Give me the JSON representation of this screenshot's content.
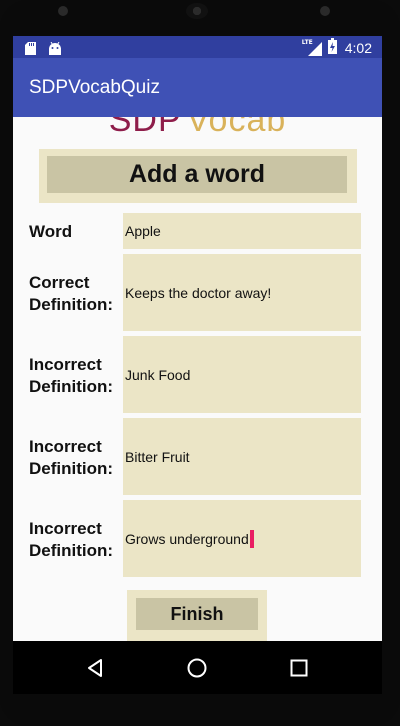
{
  "status_bar": {
    "time": "4:02",
    "network": "LTE",
    "icons": [
      "sd-card-icon",
      "android-icon",
      "signal-icon",
      "battery-icon"
    ]
  },
  "app_bar": {
    "title": "SDPVocabQuiz"
  },
  "logo": {
    "part1": "SDP",
    "part2": "Vocab"
  },
  "header": {
    "title": "Add a word"
  },
  "form": {
    "word_label": "Word",
    "word_value": "Apple",
    "correct_label_line1": "Correct",
    "correct_label_line2": "Definition:",
    "correct_value": "Keeps the doctor away!",
    "incorrect1_label_line1": "Incorrect",
    "incorrect1_label_line2": "Definition:",
    "incorrect1_value": "Junk Food",
    "incorrect2_label_line1": "Incorrect",
    "incorrect2_label_line2": "Definition:",
    "incorrect2_value": "Bitter Fruit",
    "incorrect3_label_line1": "Incorrect",
    "incorrect3_label_line2": "Definition:",
    "incorrect3_value": "Grows underground"
  },
  "finish_button": {
    "label": "Finish"
  },
  "colors": {
    "status_bar": "#303f9f",
    "app_bar": "#3f51b5",
    "field_bg": "#ebe5c6",
    "button_bg": "#c9c4a4",
    "caret": "#e91e63"
  }
}
